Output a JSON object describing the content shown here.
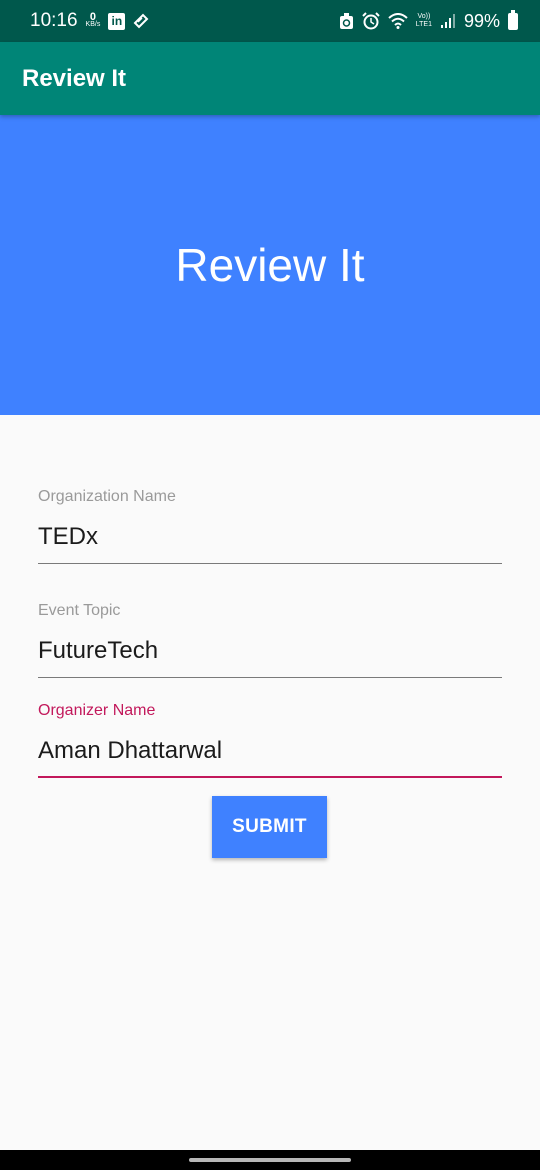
{
  "status_bar": {
    "time": "10:16",
    "data_speed_value": "0",
    "data_speed_unit": "KB/s",
    "linkedin_label": "in",
    "network_top": "Vo))",
    "network_bottom": "LTE1",
    "battery_percent": "99%",
    "icons": [
      "data-speed-icon",
      "linkedin-icon",
      "diagonal-app-icon",
      "saver-icon",
      "alarm-icon",
      "wifi-icon",
      "volte-icon",
      "signal-icon",
      "battery-icon"
    ]
  },
  "app_bar": {
    "title": "Review It"
  },
  "hero": {
    "title": "Review It"
  },
  "form": {
    "organization_name": {
      "label": "Organization Name",
      "value": "TEDx"
    },
    "event_topic": {
      "label": "Event Topic",
      "value": "FutureTech"
    },
    "organizer_name": {
      "label": "Organizer Name",
      "value": "Aman Dhattarwal",
      "focused": true
    }
  },
  "submit_label": "SUBMIT",
  "colors": {
    "status_bar": "#00584c",
    "app_bar": "#008577",
    "hero": "#3f81ff",
    "accent": "#c2185b",
    "button": "#3f81ff",
    "background": "#fafafa"
  }
}
